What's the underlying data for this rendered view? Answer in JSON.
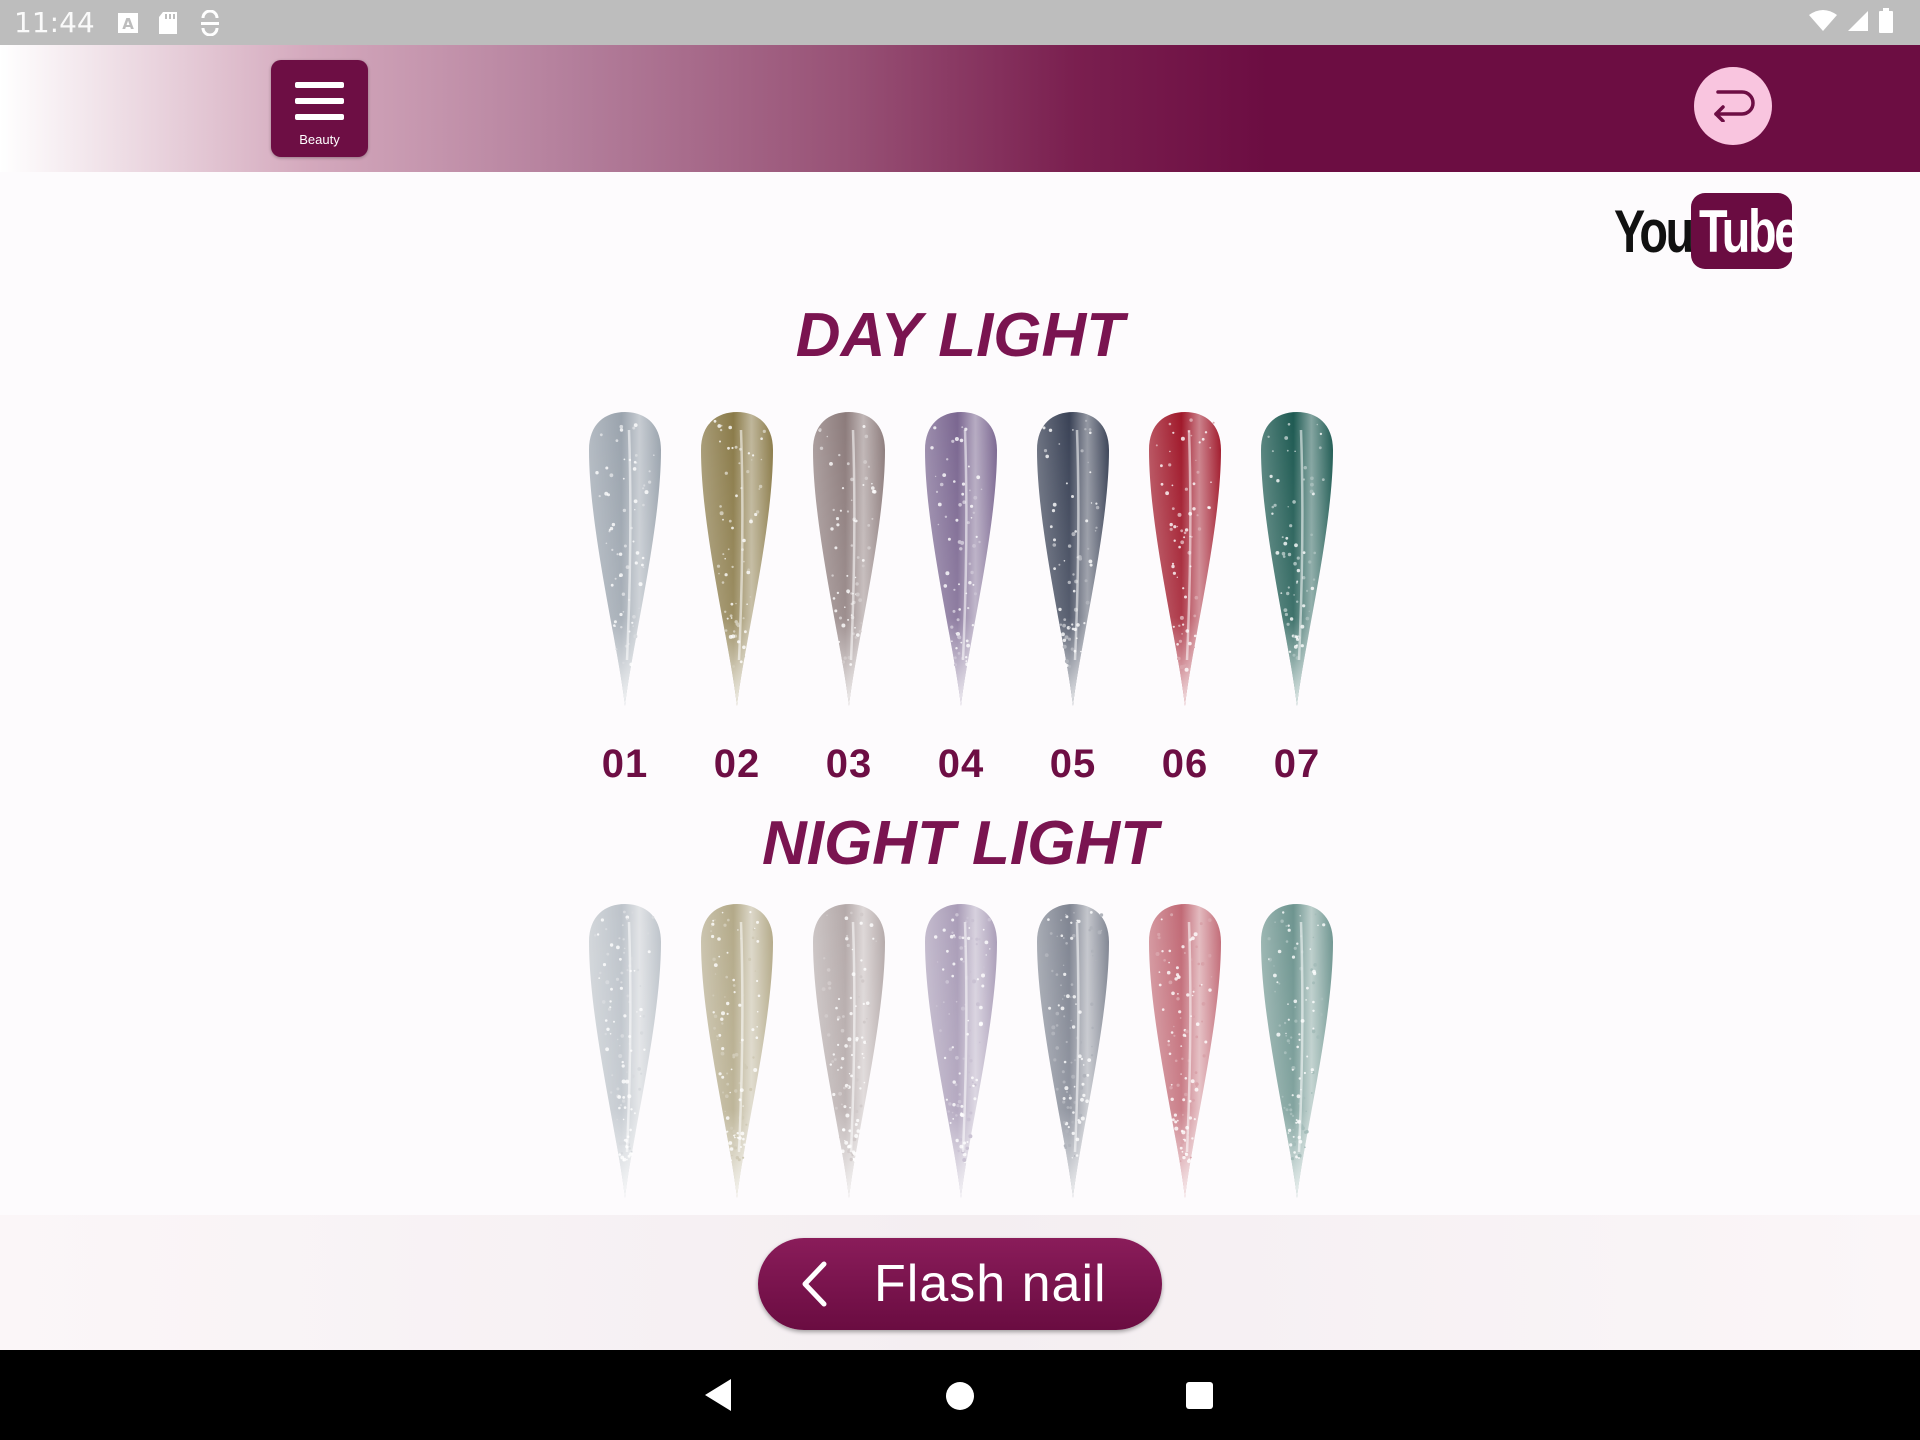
{
  "status_bar": {
    "time": "11:44",
    "icons": [
      "font-icon",
      "sd-card-icon",
      "sync-icon",
      "wifi-icon",
      "signal-icon",
      "battery-icon"
    ]
  },
  "header": {
    "menu_label": "Beauty",
    "menu_icon": "hamburger-icon",
    "back_icon": "return-arrow-icon",
    "accent_color": "#6d0e44",
    "back_circle_color": "#f9c5df"
  },
  "youtube": {
    "you": "You",
    "tube": "Tube"
  },
  "sections": {
    "day_title": "DAY LIGHT",
    "night_title": "NIGHT LIGHT"
  },
  "swatches": {
    "numbers": [
      "01",
      "02",
      "03",
      "04",
      "05",
      "06",
      "07"
    ],
    "colors": [
      "#9aa3ad",
      "#8a7a48",
      "#8c7b7b",
      "#7a6690",
      "#3a4256",
      "#a0182a",
      "#1e5a52"
    ]
  },
  "footer": {
    "button_label": "Flash nail",
    "button_icon": "chevron-left-icon"
  },
  "nav": {
    "back_icon": "triangle-back-icon",
    "home_icon": "circle-home-icon",
    "recent_icon": "square-recents-icon"
  }
}
